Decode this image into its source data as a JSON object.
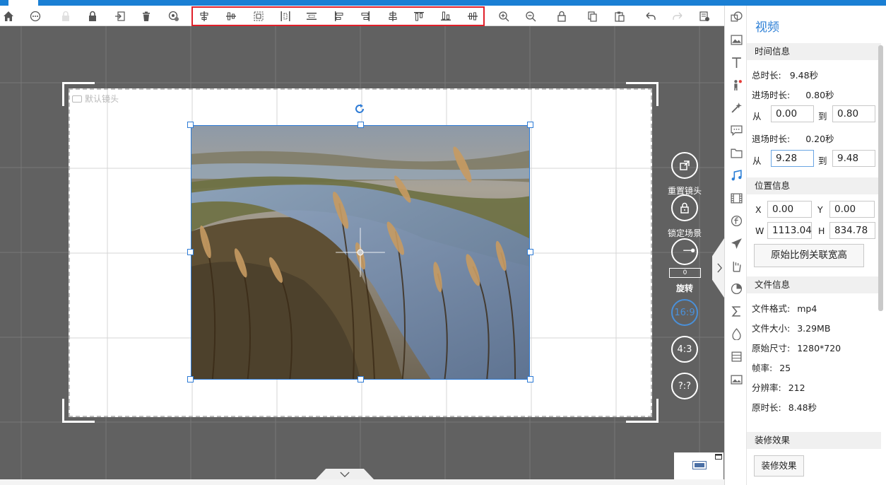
{
  "toolbar": {
    "left_icons": [
      "home-icon",
      "more-icon",
      "lock-disabled-icon",
      "lock-icon",
      "import-icon",
      "delete-icon",
      "settings-icon"
    ],
    "align_icons": [
      "align-center-horizontal-icon",
      "align-center-vertical-icon",
      "fit-frame-icon",
      "distribute-horizontal-icon",
      "distribute-vertical-icon",
      "align-left-icon",
      "align-right-icon",
      "align-center-icon",
      "align-top-icon",
      "align-bottom-icon",
      "align-middle-icon"
    ],
    "right_icons": [
      "zoom-in-icon",
      "zoom-out-icon",
      "lock-icon",
      "copy-icon",
      "paste-icon",
      "undo-icon",
      "redo-icon",
      "export-icon"
    ]
  },
  "canvas": {
    "label": "默认镜头"
  },
  "side_tools": {
    "reset_label": "重置镜头",
    "lock_label": "锁定场景",
    "rotate_value": "0",
    "rotate_label": "旋转",
    "ratio_169": "16:9",
    "ratio_43": "4:3",
    "ratio_custom": "?:?"
  },
  "panel": {
    "title": "视频",
    "time_section": "时间信息",
    "total_label": "总时长:",
    "total_value": "9.48秒",
    "in_label": "进场时长:",
    "in_value": "0.80秒",
    "from1": "从",
    "in_from": "0.00",
    "to1": "到",
    "in_to": "0.80",
    "out_label": "退场时长:",
    "out_value": "0.20秒",
    "from2": "从",
    "out_from": "9.28",
    "to2": "到",
    "out_to": "9.48",
    "pos_section": "位置信息",
    "x_label": "X",
    "x_value": "0.00",
    "y_label": "Y",
    "y_value": "0.00",
    "w_label": "W",
    "w_value": "1113.04",
    "h_label": "H",
    "h_value": "834.78",
    "ratio_button": "原始比例关联宽高",
    "file_section": "文件信息",
    "format_label": "文件格式:",
    "format_value": "mp4",
    "size_label": "文件大小:",
    "size_value": "3.29MB",
    "dim_label": "原始尺寸:",
    "dim_value": "1280*720",
    "fps_label": "帧率:",
    "fps_value": "25",
    "res_label": "分辨率:",
    "res_value": "212",
    "dur_label": "原时长:",
    "dur_value": "8.48秒",
    "decor_section": "装修效果",
    "decor_button": "装修效果"
  },
  "colors": {
    "accent": "#2c7fd6",
    "highlight_box": "#e0202a",
    "workspace": "#616161"
  }
}
